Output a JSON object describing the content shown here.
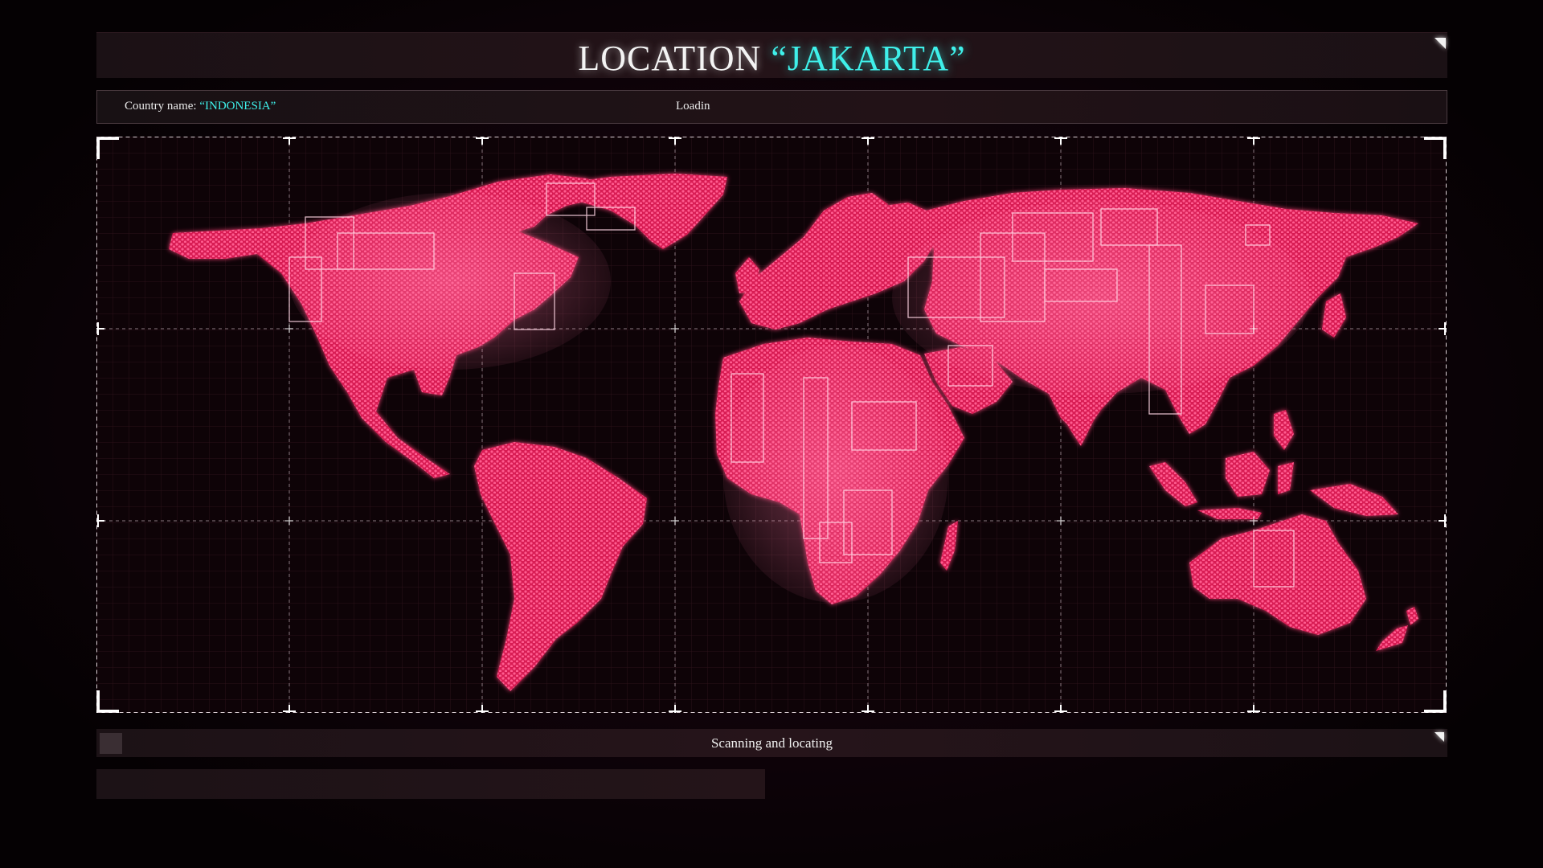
{
  "header": {
    "title_prefix": "LOCATION ",
    "title_location": "“JAKARTA”"
  },
  "info": {
    "country_label": "Country name: ",
    "country_value": "“INDONESIA”",
    "loading": "Loadin"
  },
  "status": {
    "text": "Scanning and locating"
  },
  "colors": {
    "accent": "#3ff0ea",
    "land": "#e8245e",
    "land_glow": "#ff4d87",
    "background": "#0e0307"
  }
}
